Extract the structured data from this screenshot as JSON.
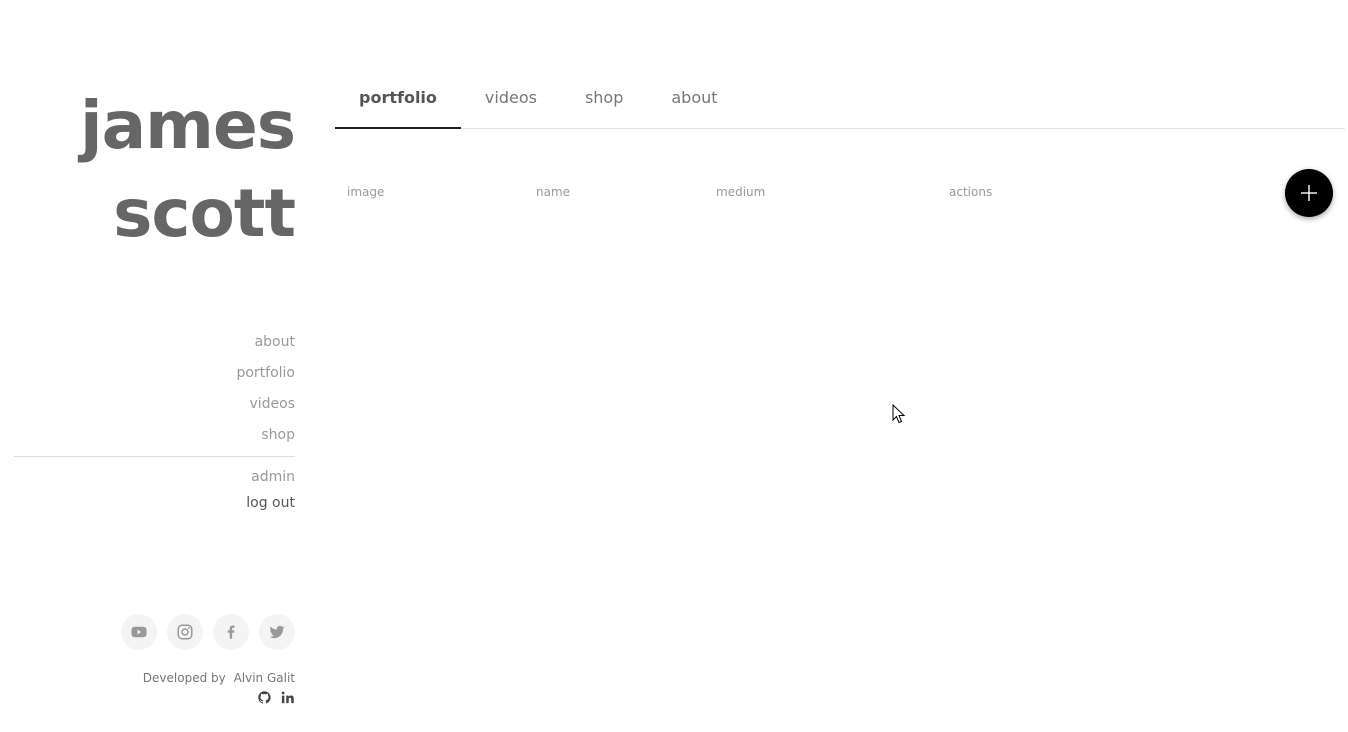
{
  "brand": {
    "line1": "james",
    "line2": "scott"
  },
  "sidebar": {
    "nav": [
      {
        "label": "about"
      },
      {
        "label": "portfolio"
      },
      {
        "label": "videos"
      },
      {
        "label": "shop"
      }
    ],
    "admin_label": "admin",
    "logout_label": "log out",
    "socials": [
      {
        "icon": "youtube-icon"
      },
      {
        "icon": "instagram-icon"
      },
      {
        "icon": "facebook-icon"
      },
      {
        "icon": "twitter-icon"
      }
    ],
    "credits": {
      "prefix": "Developed by",
      "name": "Alvin Galit",
      "icons": [
        "github-icon",
        "linkedin-icon"
      ]
    }
  },
  "tabs": [
    {
      "label": "portfolio",
      "active": true
    },
    {
      "label": "videos",
      "active": false
    },
    {
      "label": "shop",
      "active": false
    },
    {
      "label": "about",
      "active": false
    }
  ],
  "table": {
    "columns": [
      "image",
      "name",
      "medium",
      "actions"
    ]
  },
  "fab": {
    "icon": "plus-icon"
  },
  "colors": {
    "brand_text": "#666666",
    "muted_text": "#999999",
    "fab_bg": "#000000",
    "tab_underline": "#222222"
  }
}
